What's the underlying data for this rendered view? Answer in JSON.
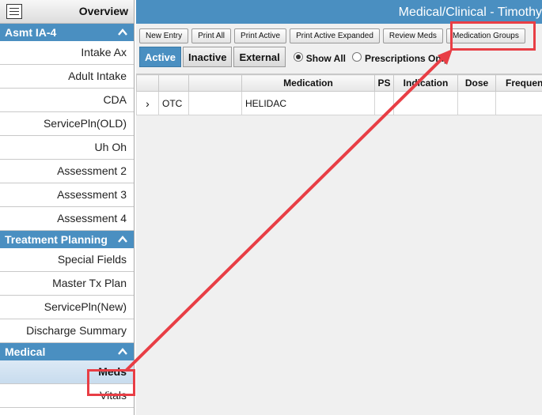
{
  "sidebar": {
    "overview_label": "Overview",
    "sections": [
      {
        "title": "Asmt IA-4",
        "items": [
          "Intake Ax",
          "Adult Intake",
          "CDA",
          "ServicePln(OLD)",
          "Uh Oh",
          "Assessment 2",
          "Assessment 3",
          "Assessment 4"
        ]
      },
      {
        "title": "Treatment Planning",
        "items": [
          "Special Fields",
          "Master Tx Plan",
          "ServicePln(New)",
          "Discharge Summary"
        ]
      },
      {
        "title": "Medical",
        "items": [
          "Meds",
          "Vitals"
        ],
        "active": "Meds"
      }
    ]
  },
  "header": {
    "title": "Medical/Clinical - Timothy"
  },
  "toolbar": {
    "buttons": [
      "New Entry",
      "Print All",
      "Print Active",
      "Print Active Expanded",
      "Review Meds",
      "Medication Groups"
    ]
  },
  "tabs": {
    "items": [
      "Active",
      "Inactive",
      "External"
    ],
    "active": "Active"
  },
  "filter": {
    "show_all": "Show All",
    "prescriptions_only": "Prescriptions Only",
    "selected": "Show All"
  },
  "grid": {
    "columns": [
      "",
      "",
      "",
      "Medication",
      "PS",
      "Indication",
      "Dose",
      "Frequency"
    ],
    "rows": [
      {
        "expander": "›",
        "type": "OTC",
        "blank": "",
        "medication": "HELIDAC",
        "ps": "",
        "indication": "",
        "dose": "",
        "frequency": ""
      }
    ]
  },
  "annotation": {
    "color": "#e83e45"
  },
  "colors": {
    "accent": "#4a8fc1"
  }
}
